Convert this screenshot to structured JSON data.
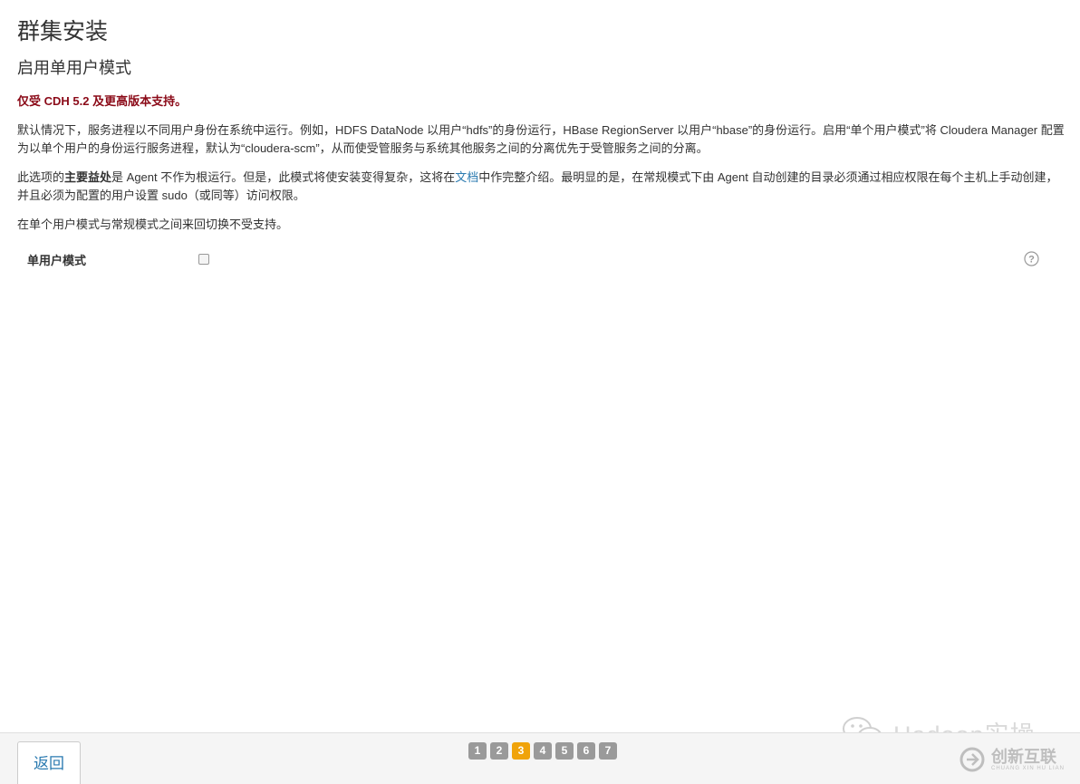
{
  "page": {
    "title": "群集安装",
    "subtitle": "启用单用户模式",
    "warning": "仅受 CDH 5.2 及更高版本支持。",
    "para1": "默认情况下，服务进程以不同用户身份在系统中运行。例如，HDFS DataNode 以用户“hdfs”的身份运行，HBase RegionServer 以用户“hbase”的身份运行。启用“单个用户模式”将 Cloudera Manager 配置为以单个用户的身份运行服务进程，默认为“cloudera-scm”，从而使受管服务与系统其他服务之间的分离优先于受管服务之间的分离。",
    "para2_pre": "此选项的",
    "para2_bold": "主要益处",
    "para2_mid": "是 Agent 不作为根运行。但是，此模式将使安装变得复杂，这将在",
    "para2_link": "文档",
    "para2_post": "中作完整介绍。最明显的是，在常规模式下由 Agent 自动创建的目录必须通过相应权限在每个主机上手动创建，并且必须为配置的用户设置 sudo（或同等）访问权限。",
    "para3": "在单个用户模式与常规模式之间来回切换不受支持。"
  },
  "form": {
    "single_user_label": "单用户模式",
    "single_user_checked": false,
    "help_icon": "question-circle-icon"
  },
  "footer": {
    "back_label": "返回",
    "steps": [
      "1",
      "2",
      "3",
      "4",
      "5",
      "6",
      "7"
    ],
    "active_step": "3"
  },
  "watermarks": {
    "wechat_text": "Hadoop实操",
    "brand_main": "创新互联",
    "brand_sub": "CHUANG XIN HU LIAN"
  },
  "colors": {
    "warning": "#8b0a18",
    "link": "#2a7ab0",
    "step_active": "#f0a30a",
    "step_inactive": "#9a9a9a"
  }
}
